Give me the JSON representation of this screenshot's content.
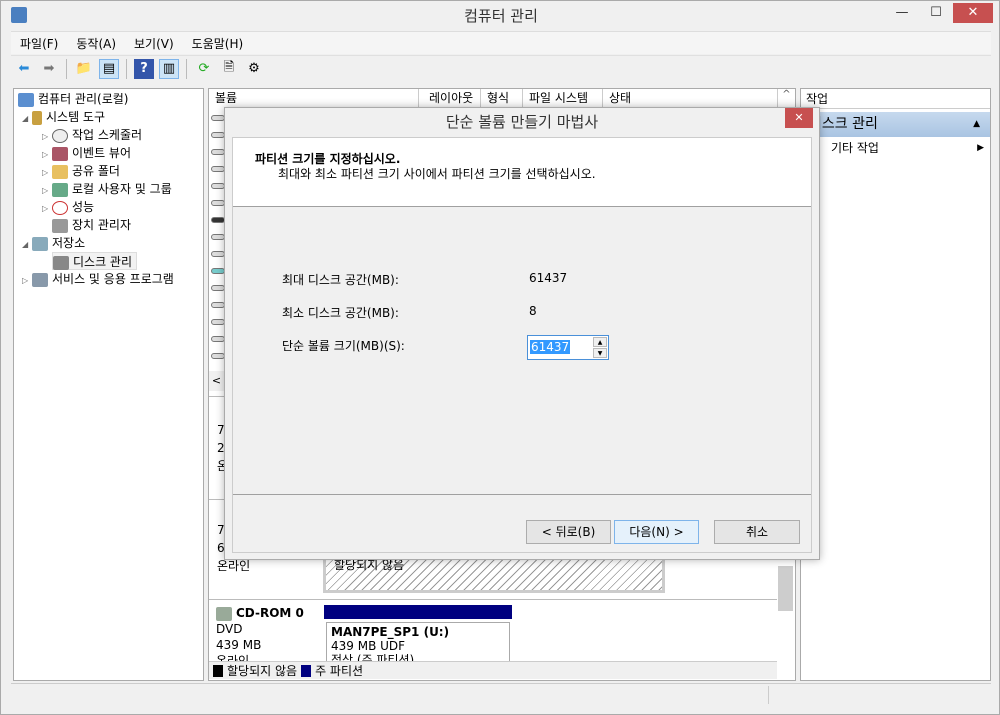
{
  "window": {
    "title": "컴퓨터 관리",
    "minimize": "—",
    "maximize": "☐",
    "close": "✕"
  },
  "menu": [
    "파일(F)",
    "동작(A)",
    "보기(V)",
    "도움말(H)"
  ],
  "toolbar": {
    "back": "⬅",
    "forward": "➡",
    "up": "📁",
    "show_tree": "▤",
    "help": "?",
    "show_action": "▥",
    "refresh": "⟳",
    "properties": "🗎",
    "export": "⚙"
  },
  "tree": {
    "root": "컴퓨터 관리(로컬)",
    "system_tools": "시스템 도구",
    "task_scheduler": "작업 스케줄러",
    "event_viewer": "이벤트 뷰어",
    "shared_folders": "공유 폴더",
    "local_users": "로컬 사용자 및 그룹",
    "performance": "성능",
    "device_manager": "장치 관리자",
    "storage": "저장소",
    "disk_management": "디스크 관리",
    "services": "서비스 및 응용 프로그램"
  },
  "volume_list": {
    "columns": [
      "볼륨",
      "레이아웃",
      "형식",
      "파일 시스템",
      "상태"
    ]
  },
  "disks": {
    "disk1_partial": [
      "7",
      "2",
      "온"
    ],
    "disk2_partial": [
      "7",
      "6",
      "온라인"
    ],
    "unallocated_label": "할당되지 않음",
    "cdrom": {
      "name": "CD-ROM 0",
      "type": "DVD",
      "size": "439 MB",
      "status": "온라인",
      "volume_name": "MAN7PE_SP1  (U:)",
      "volume_info": "439 MB UDF",
      "volume_status": "정상 (주 파티션)"
    }
  },
  "legend": [
    {
      "label": "할당되지 않음",
      "color": "#000000"
    },
    {
      "label": "주 파티션",
      "color": "#000080"
    }
  ],
  "actions": {
    "header": "작업",
    "section": "디스크 관리",
    "item": "기타 작업"
  },
  "dialog": {
    "title": "단순 볼륨 만들기 마법사",
    "close": "✕",
    "heading": "파티션 크기를 지정하십시오.",
    "subheading": "최대와 최소 파티션 크기 사이에서 파티션 크기를 선택하십시오.",
    "max_label": "최대 디스크 공간(MB):",
    "max_value": "61437",
    "min_label": "최소 디스크 공간(MB):",
    "min_value": "8",
    "size_label": "단순 볼륨 크기(MB)(S):",
    "size_value": "61437",
    "back": "< 뒤로(B)",
    "next": "다음(N) >",
    "cancel": "취소"
  },
  "colors": {
    "close_button": "#c75050",
    "partition": "#000080",
    "selection": "#3399ff"
  }
}
